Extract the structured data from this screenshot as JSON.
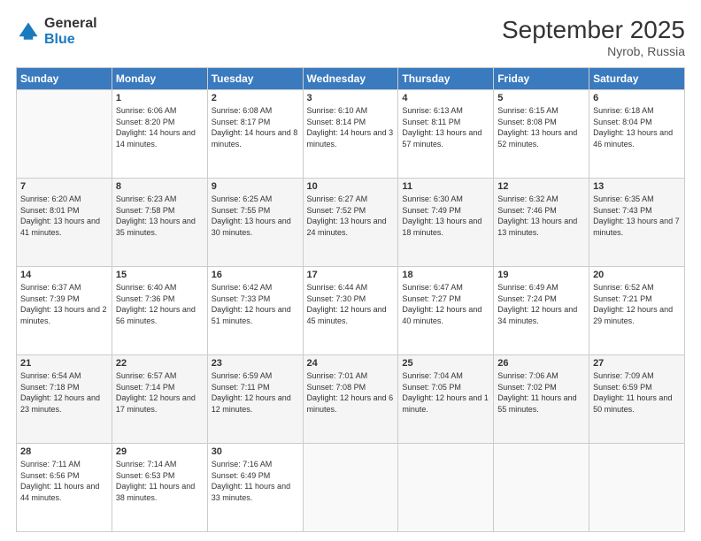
{
  "logo": {
    "general": "General",
    "blue": "Blue"
  },
  "title": "September 2025",
  "location": "Nyrob, Russia",
  "days_of_week": [
    "Sunday",
    "Monday",
    "Tuesday",
    "Wednesday",
    "Thursday",
    "Friday",
    "Saturday"
  ],
  "weeks": [
    [
      {
        "num": "",
        "sunrise": "",
        "sunset": "",
        "daylight": ""
      },
      {
        "num": "1",
        "sunrise": "Sunrise: 6:06 AM",
        "sunset": "Sunset: 8:20 PM",
        "daylight": "Daylight: 14 hours and 14 minutes."
      },
      {
        "num": "2",
        "sunrise": "Sunrise: 6:08 AM",
        "sunset": "Sunset: 8:17 PM",
        "daylight": "Daylight: 14 hours and 8 minutes."
      },
      {
        "num": "3",
        "sunrise": "Sunrise: 6:10 AM",
        "sunset": "Sunset: 8:14 PM",
        "daylight": "Daylight: 14 hours and 3 minutes."
      },
      {
        "num": "4",
        "sunrise": "Sunrise: 6:13 AM",
        "sunset": "Sunset: 8:11 PM",
        "daylight": "Daylight: 13 hours and 57 minutes."
      },
      {
        "num": "5",
        "sunrise": "Sunrise: 6:15 AM",
        "sunset": "Sunset: 8:08 PM",
        "daylight": "Daylight: 13 hours and 52 minutes."
      },
      {
        "num": "6",
        "sunrise": "Sunrise: 6:18 AM",
        "sunset": "Sunset: 8:04 PM",
        "daylight": "Daylight: 13 hours and 46 minutes."
      }
    ],
    [
      {
        "num": "7",
        "sunrise": "Sunrise: 6:20 AM",
        "sunset": "Sunset: 8:01 PM",
        "daylight": "Daylight: 13 hours and 41 minutes."
      },
      {
        "num": "8",
        "sunrise": "Sunrise: 6:23 AM",
        "sunset": "Sunset: 7:58 PM",
        "daylight": "Daylight: 13 hours and 35 minutes."
      },
      {
        "num": "9",
        "sunrise": "Sunrise: 6:25 AM",
        "sunset": "Sunset: 7:55 PM",
        "daylight": "Daylight: 13 hours and 30 minutes."
      },
      {
        "num": "10",
        "sunrise": "Sunrise: 6:27 AM",
        "sunset": "Sunset: 7:52 PM",
        "daylight": "Daylight: 13 hours and 24 minutes."
      },
      {
        "num": "11",
        "sunrise": "Sunrise: 6:30 AM",
        "sunset": "Sunset: 7:49 PM",
        "daylight": "Daylight: 13 hours and 18 minutes."
      },
      {
        "num": "12",
        "sunrise": "Sunrise: 6:32 AM",
        "sunset": "Sunset: 7:46 PM",
        "daylight": "Daylight: 13 hours and 13 minutes."
      },
      {
        "num": "13",
        "sunrise": "Sunrise: 6:35 AM",
        "sunset": "Sunset: 7:43 PM",
        "daylight": "Daylight: 13 hours and 7 minutes."
      }
    ],
    [
      {
        "num": "14",
        "sunrise": "Sunrise: 6:37 AM",
        "sunset": "Sunset: 7:39 PM",
        "daylight": "Daylight: 13 hours and 2 minutes."
      },
      {
        "num": "15",
        "sunrise": "Sunrise: 6:40 AM",
        "sunset": "Sunset: 7:36 PM",
        "daylight": "Daylight: 12 hours and 56 minutes."
      },
      {
        "num": "16",
        "sunrise": "Sunrise: 6:42 AM",
        "sunset": "Sunset: 7:33 PM",
        "daylight": "Daylight: 12 hours and 51 minutes."
      },
      {
        "num": "17",
        "sunrise": "Sunrise: 6:44 AM",
        "sunset": "Sunset: 7:30 PM",
        "daylight": "Daylight: 12 hours and 45 minutes."
      },
      {
        "num": "18",
        "sunrise": "Sunrise: 6:47 AM",
        "sunset": "Sunset: 7:27 PM",
        "daylight": "Daylight: 12 hours and 40 minutes."
      },
      {
        "num": "19",
        "sunrise": "Sunrise: 6:49 AM",
        "sunset": "Sunset: 7:24 PM",
        "daylight": "Daylight: 12 hours and 34 minutes."
      },
      {
        "num": "20",
        "sunrise": "Sunrise: 6:52 AM",
        "sunset": "Sunset: 7:21 PM",
        "daylight": "Daylight: 12 hours and 29 minutes."
      }
    ],
    [
      {
        "num": "21",
        "sunrise": "Sunrise: 6:54 AM",
        "sunset": "Sunset: 7:18 PM",
        "daylight": "Daylight: 12 hours and 23 minutes."
      },
      {
        "num": "22",
        "sunrise": "Sunrise: 6:57 AM",
        "sunset": "Sunset: 7:14 PM",
        "daylight": "Daylight: 12 hours and 17 minutes."
      },
      {
        "num": "23",
        "sunrise": "Sunrise: 6:59 AM",
        "sunset": "Sunset: 7:11 PM",
        "daylight": "Daylight: 12 hours and 12 minutes."
      },
      {
        "num": "24",
        "sunrise": "Sunrise: 7:01 AM",
        "sunset": "Sunset: 7:08 PM",
        "daylight": "Daylight: 12 hours and 6 minutes."
      },
      {
        "num": "25",
        "sunrise": "Sunrise: 7:04 AM",
        "sunset": "Sunset: 7:05 PM",
        "daylight": "Daylight: 12 hours and 1 minute."
      },
      {
        "num": "26",
        "sunrise": "Sunrise: 7:06 AM",
        "sunset": "Sunset: 7:02 PM",
        "daylight": "Daylight: 11 hours and 55 minutes."
      },
      {
        "num": "27",
        "sunrise": "Sunrise: 7:09 AM",
        "sunset": "Sunset: 6:59 PM",
        "daylight": "Daylight: 11 hours and 50 minutes."
      }
    ],
    [
      {
        "num": "28",
        "sunrise": "Sunrise: 7:11 AM",
        "sunset": "Sunset: 6:56 PM",
        "daylight": "Daylight: 11 hours and 44 minutes."
      },
      {
        "num": "29",
        "sunrise": "Sunrise: 7:14 AM",
        "sunset": "Sunset: 6:53 PM",
        "daylight": "Daylight: 11 hours and 38 minutes."
      },
      {
        "num": "30",
        "sunrise": "Sunrise: 7:16 AM",
        "sunset": "Sunset: 6:49 PM",
        "daylight": "Daylight: 11 hours and 33 minutes."
      },
      {
        "num": "",
        "sunrise": "",
        "sunset": "",
        "daylight": ""
      },
      {
        "num": "",
        "sunrise": "",
        "sunset": "",
        "daylight": ""
      },
      {
        "num": "",
        "sunrise": "",
        "sunset": "",
        "daylight": ""
      },
      {
        "num": "",
        "sunrise": "",
        "sunset": "",
        "daylight": ""
      }
    ]
  ]
}
